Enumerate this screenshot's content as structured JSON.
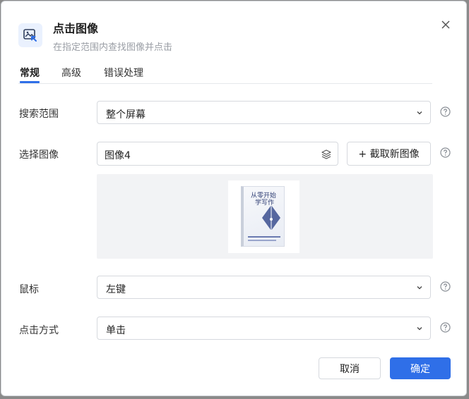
{
  "dialog": {
    "title": "点击图像",
    "subtitle": "在指定范围内查找图像并点击"
  },
  "tabs": [
    {
      "label": "常规",
      "active": true
    },
    {
      "label": "高级",
      "active": false
    },
    {
      "label": "错误处理",
      "active": false
    }
  ],
  "fields": {
    "search_range": {
      "label": "搜索范围",
      "value": "整个屏幕"
    },
    "select_image": {
      "label": "选择图像",
      "value": "图像4",
      "capture_label": "+ 截取新图像"
    },
    "mouse": {
      "label": "鼠标",
      "value": "左键"
    },
    "click_mode": {
      "label": "点击方式",
      "value": "单击"
    }
  },
  "preview": {
    "book_title_line1": "从零开始",
    "book_title_line2": "学写作"
  },
  "footer": {
    "cancel_label": "取消",
    "ok_label": "确定"
  },
  "colors": {
    "accent": "#2f6fe8",
    "icon_bg": "#eaf1fe",
    "preview_bg": "#f2f3f5"
  },
  "icons": {
    "header": "image-click-icon",
    "close": "close-icon",
    "chevron": "chevron-down-icon",
    "help": "help-circle-icon",
    "layers": "layers-icon"
  }
}
